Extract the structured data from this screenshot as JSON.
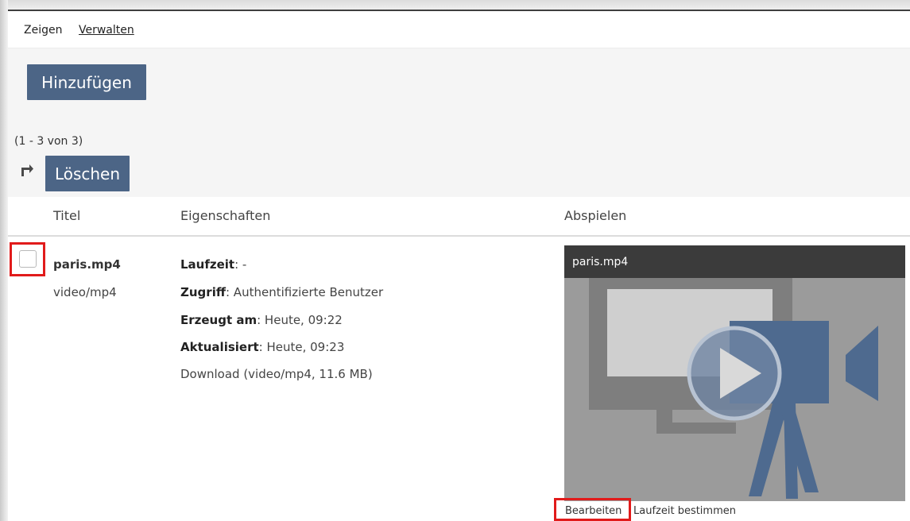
{
  "tabs": {
    "show": "Zeigen",
    "manage": "Verwalten"
  },
  "toolbar": {
    "add_label": "Hinzufügen"
  },
  "list": {
    "count": "(1 - 3 von 3)",
    "delete_label": "Löschen"
  },
  "table": {
    "headers": {
      "title": "Titel",
      "properties": "Eigenschaften",
      "play": "Abspielen"
    },
    "row": {
      "filename": "paris.mp4",
      "mimetype": "video/mp4",
      "duration_label": "Laufzeit",
      "duration_value": ": -",
      "access_label": "Zugriff",
      "access_value": ": Authentifizierte Benutzer",
      "created_label": "Erzeugt am",
      "created_value": ": Heute, 09:22",
      "updated_label": "Aktualisiert",
      "updated_value": ": Heute, 09:23",
      "download": "Download (video/mp4, 11.6 MB)",
      "player_title": "paris.mp4",
      "edit_link": "Bearbeiten",
      "duration_link": "Laufzeit bestimmen"
    }
  },
  "colors": {
    "button_bg": "#4c6586",
    "highlight": "#e11b1b",
    "player_bg": "#9b9b9b",
    "player_titlebar": "#3b3b3b"
  },
  "icons": [
    "forward-arrow-icon",
    "checkbox",
    "video-poster-icon"
  ]
}
